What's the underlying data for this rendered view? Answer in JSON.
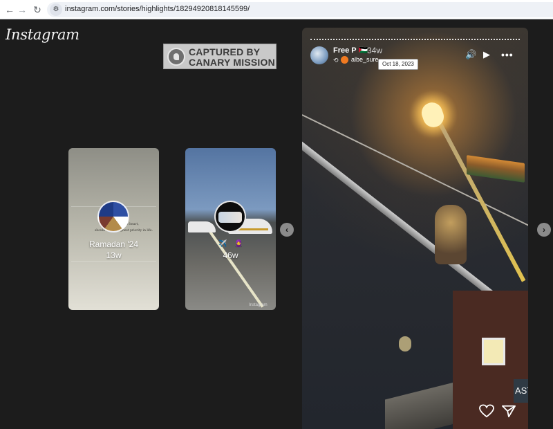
{
  "browser": {
    "url": "instagram.com/stories/highlights/18294920818145599/",
    "back_icon": "←",
    "forward_icon": "→",
    "reload_icon": "↻",
    "site_info_icon": "⚙"
  },
  "app": {
    "logo": "Instagram"
  },
  "watermark": {
    "line1": "CAPTURED BY",
    "line2": "CANARY MISSION"
  },
  "highlights": [
    {
      "title": "Ramadan '24",
      "age": "13w",
      "quote_line1": "a pure heart,",
      "quote_line2": "should be our highest priority in life."
    },
    {
      "title": "",
      "age": "46w",
      "emojis": "✈️ 🧕",
      "photo_credit": "Instagram"
    }
  ],
  "nav": {
    "prev_icon": "‹",
    "next_icon": "›"
  },
  "story": {
    "username": "Free P 🇵🇸",
    "time": "34w",
    "repost_icon": "⟲",
    "reposter": "albe_sure",
    "tooltip_date": "Oct 18, 2023",
    "sound_icon": "🔊",
    "play_icon": "▶",
    "more_icon": "•••",
    "sign_text": "AST"
  },
  "colors": {
    "page_bg": "#1c1c1c",
    "watermark_bg": "#c9c9c9",
    "reposter_accent": "#f07a21"
  }
}
